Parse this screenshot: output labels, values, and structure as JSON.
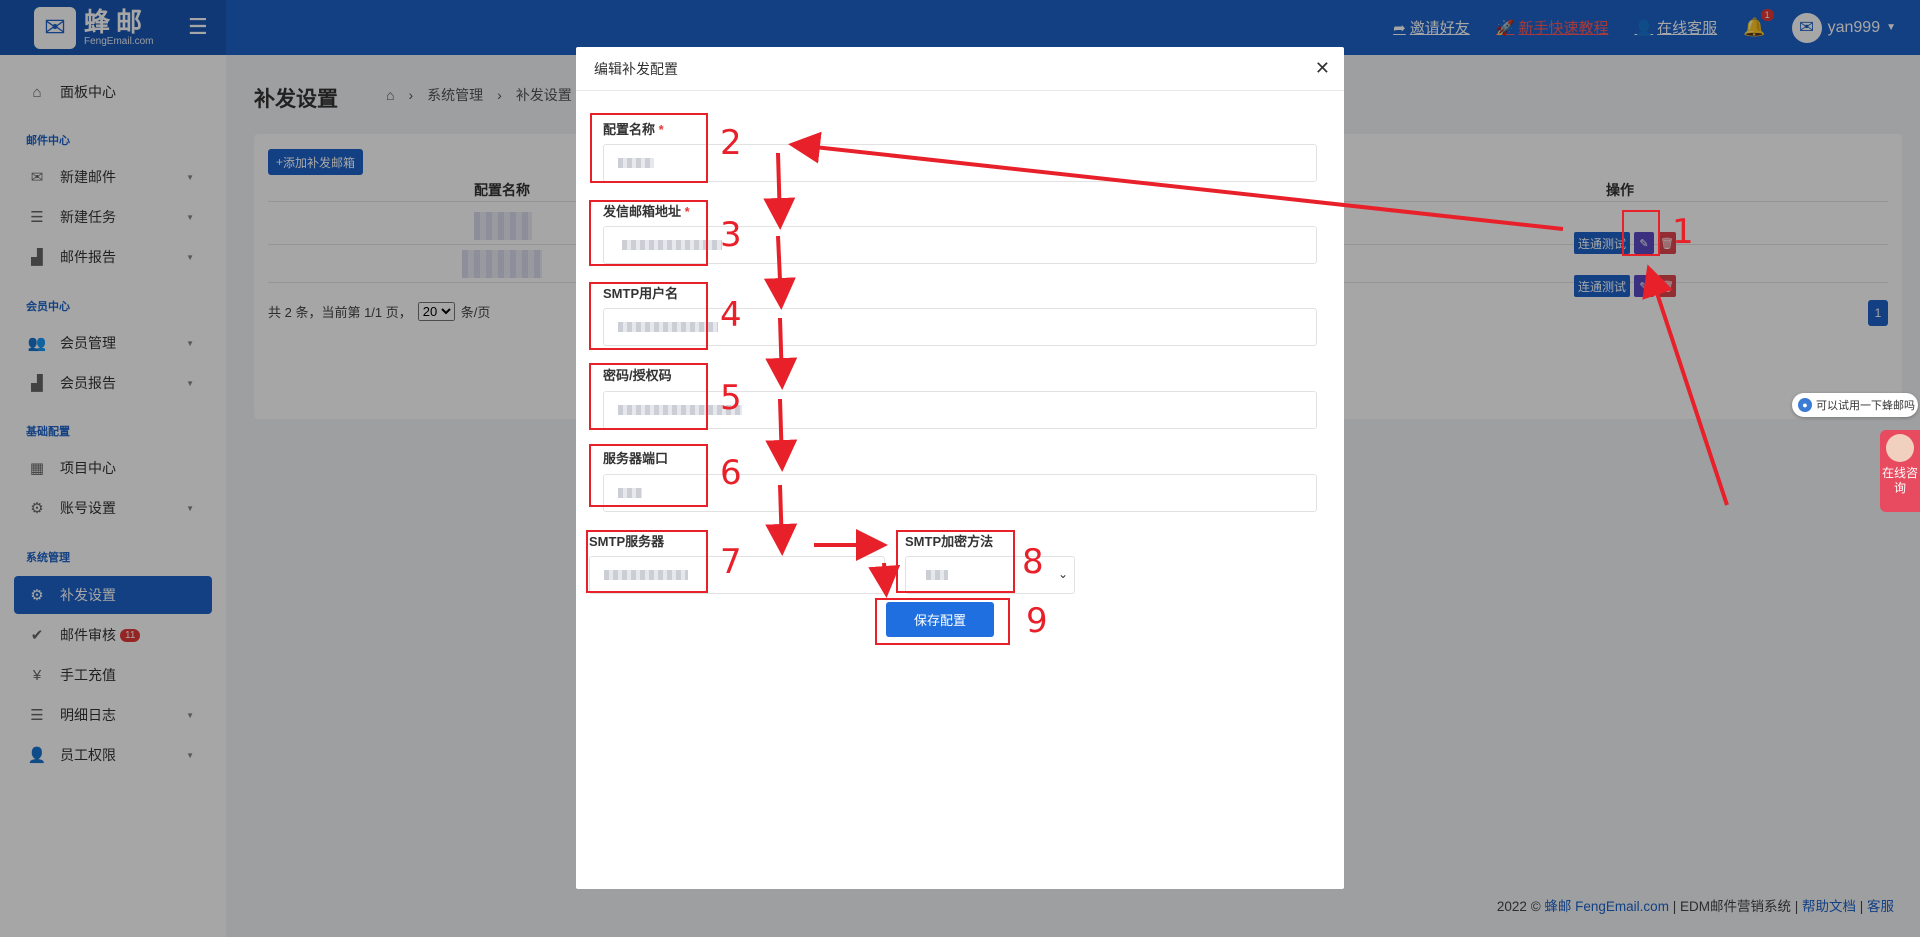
{
  "brand": {
    "name": "蜂邮",
    "sub": "FengEmail.com"
  },
  "topbar": {
    "invite": "邀请好友",
    "tutorial": "新手快速教程",
    "support": "在线客服",
    "bell_count": "1",
    "username": "yan999"
  },
  "sidebar": {
    "dashboard": "面板中心",
    "sec_mail": "邮件中心",
    "new_mail": "新建邮件",
    "new_task": "新建任务",
    "mail_report": "邮件报告",
    "sec_member": "会员中心",
    "member_manage": "会员管理",
    "member_report": "会员报告",
    "sec_base": "基础配置",
    "project_center": "项目中心",
    "account_settings": "账号设置",
    "sec_system": "系统管理",
    "resend_settings": "补发设置",
    "mail_review": "邮件审核",
    "mail_review_badge": "11",
    "manual_recharge": "手工充值",
    "detail_log": "明细日志",
    "staff_perm": "员工权限"
  },
  "page": {
    "title": "补发设置",
    "crumb_system": "系统管理",
    "crumb_current": "补发设置",
    "add_button": "添加补发邮箱",
    "col_config_name": "配置名称",
    "col_ops": "操作",
    "test_label": "连通测试",
    "pager_summary": "共 2 条，当前第 1/1 页，",
    "pager_size": "20",
    "pager_unit": "条/页",
    "page_number": "1"
  },
  "footer": {
    "copyright": "2022 ©",
    "brand_link": "蜂邮 FengEmail.com",
    "sep1": " | ",
    "edm": "EDM邮件营销系统",
    "sep2": " | ",
    "help": "帮助文档",
    "sep3": " | ",
    "service": "客服"
  },
  "widget": {
    "bubble": "可以试用一下蜂邮吗",
    "consult": "在线咨询"
  },
  "modal": {
    "title": "编辑补发配置",
    "config_name_label": "配置名称",
    "sender_label": "发信邮箱地址",
    "smtp_user_label": "SMTP用户名",
    "password_label": "密码/授权码",
    "port_label": "服务器端口",
    "smtp_server_label": "SMTP服务器",
    "smtp_enc_label": "SMTP加密方法",
    "required_mark": "*",
    "save_button": "保存配置"
  },
  "annotations": [
    "1",
    "2",
    "3",
    "4",
    "5",
    "6",
    "7",
    "8",
    "9"
  ],
  "colors": {
    "primary": "#1e63c9",
    "annotation": "#e8202a",
    "danger": "#e0454f"
  }
}
